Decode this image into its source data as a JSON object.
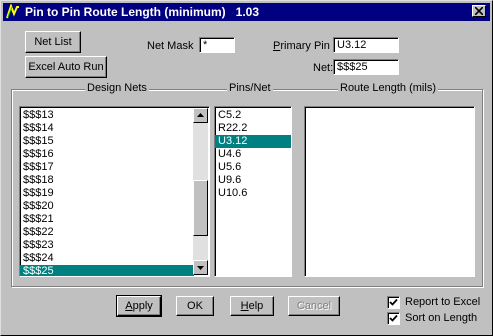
{
  "window": {
    "title": "Pin to Pin Route Length (minimum)   1.03"
  },
  "buttons": {
    "net_list": "Net List",
    "excel_auto_run": "Excel Auto Run"
  },
  "net_mask": {
    "label": "Net Mask",
    "value": "*"
  },
  "primary_pin": {
    "label_accel": "P",
    "label_rest": "rimary Pin",
    "value": "U3.12"
  },
  "net": {
    "label": "Net:",
    "value": "$$$25"
  },
  "columns": {
    "design_nets": "Design Nets",
    "pins_per_net": "Pins/Net",
    "route_length": "Route Length   (mils)"
  },
  "design_nets": {
    "items": [
      "$$$13",
      "$$$14",
      "$$$15",
      "$$$16",
      "$$$17",
      "$$$18",
      "$$$19",
      "$$$20",
      "$$$21",
      "$$$22",
      "$$$23",
      "$$$24",
      "$$$25"
    ],
    "selected": "$$$25"
  },
  "pins": {
    "items": [
      "C5.2",
      "R22.2",
      "U3.12",
      "U4.6",
      "U5.6",
      "U9.6",
      "U10.6"
    ],
    "selected": "U3.12"
  },
  "route_lengths": {
    "items": []
  },
  "footer": {
    "apply_accel": "A",
    "apply_rest": "pply",
    "ok": "OK",
    "help_accel": "H",
    "help_rest": "elp",
    "cancel": "Cancel",
    "report_to_excel": "Report to Excel",
    "sort_on_length": "Sort on Length"
  },
  "checkboxes": {
    "report_to_excel": true,
    "sort_on_length": true
  },
  "colors": {
    "titlebar": "#000080",
    "selection": "#008080",
    "face": "#c0c0c0"
  }
}
